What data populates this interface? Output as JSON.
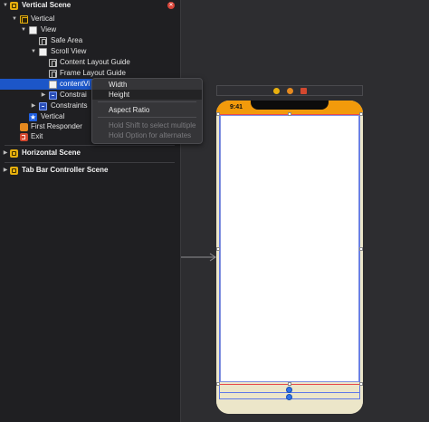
{
  "outline": {
    "rows": [
      {
        "label": "Vertical Scene",
        "icon": "scene-icon",
        "tri": "▼",
        "bold": true
      },
      {
        "label": "Vertical",
        "icon": "view-controller-icon",
        "tri": "▼"
      },
      {
        "label": "View",
        "icon": "view-icon",
        "tri": "▼"
      },
      {
        "label": "Safe Area",
        "icon": "layout-guide-icon",
        "tri": ""
      },
      {
        "label": "Scroll View",
        "icon": "view-icon",
        "tri": "▼"
      },
      {
        "label": "Content Layout Guide",
        "icon": "layout-guide-icon",
        "tri": ""
      },
      {
        "label": "Frame Layout Guide",
        "icon": "layout-guide-icon",
        "tri": ""
      },
      {
        "label": "contentVi",
        "icon": "view-icon",
        "tri": "",
        "selected": true
      },
      {
        "label": "Constrai",
        "icon": "constraints-icon",
        "tri": "▶"
      },
      {
        "label": "Constraints",
        "icon": "constraints-icon",
        "tri": "▶"
      },
      {
        "label": "Vertical",
        "icon": "storyboard-entry-icon",
        "tri": ""
      },
      {
        "label": "First Responder",
        "icon": "first-responder-icon",
        "tri": ""
      },
      {
        "label": "Exit",
        "icon": "exit-icon",
        "tri": ""
      }
    ],
    "scenes": [
      {
        "label": "Horizontal Scene",
        "icon": "scene-icon",
        "tri": "▶"
      },
      {
        "label": "Tab Bar Controller Scene",
        "icon": "scene-icon",
        "tri": "▶"
      }
    ],
    "close_glyph": "✕"
  },
  "context_menu": {
    "items": [
      {
        "label": "Width",
        "highlighted": false,
        "disabled": false
      },
      {
        "label": "Height",
        "highlighted": true,
        "disabled": false
      },
      {
        "label": "Aspect Ratio",
        "highlighted": false,
        "disabled": false
      },
      {
        "label": "Hold Shift to select multiple",
        "highlighted": false,
        "disabled": true
      },
      {
        "label": "Hold Option for alternates",
        "highlighted": false,
        "disabled": true
      }
    ]
  },
  "device": {
    "time": "9:41",
    "status_bar_color": "#f29a0b",
    "home_area_color": "#ece6c9"
  },
  "colors": {
    "selection": "#1c56c8",
    "constraint_red": "#e84a4a",
    "constraint_blue": "#5f79e8"
  }
}
